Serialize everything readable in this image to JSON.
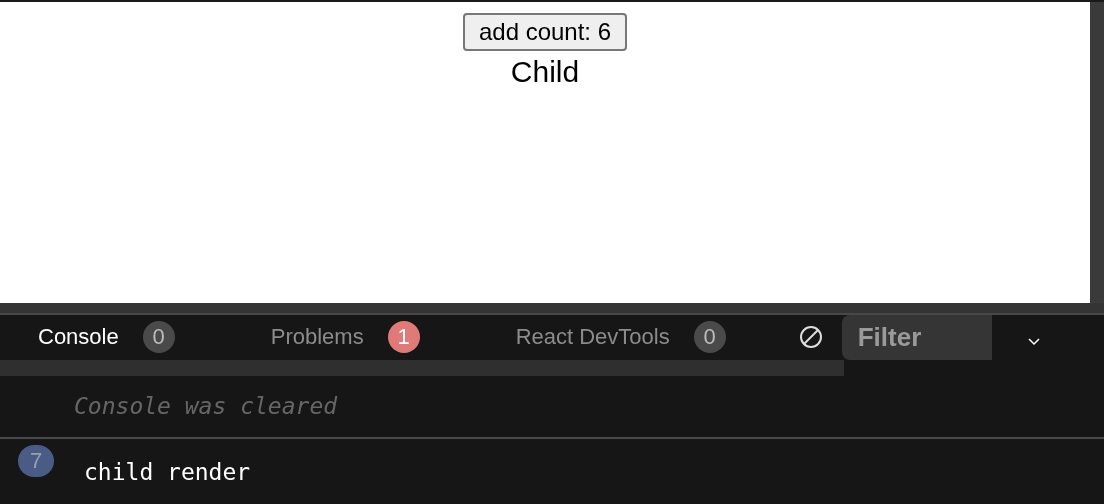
{
  "preview": {
    "button": "add count: 6",
    "text": "Child"
  },
  "tabs": [
    {
      "label": "Console",
      "count": "0",
      "selected": true,
      "color": "#4a4a4a"
    },
    {
      "label": "Problems",
      "count": "1",
      "selected": false,
      "color": "#e07a78"
    },
    {
      "label": "React DevTools",
      "count": "0",
      "selected": false,
      "color": "#4a4a4a"
    }
  ],
  "filter": {
    "placeholder": "Filter"
  },
  "messages": [
    {
      "kind": "info",
      "text": "Console was cleared"
    },
    {
      "kind": "log",
      "count": "7",
      "text": "child render"
    }
  ]
}
